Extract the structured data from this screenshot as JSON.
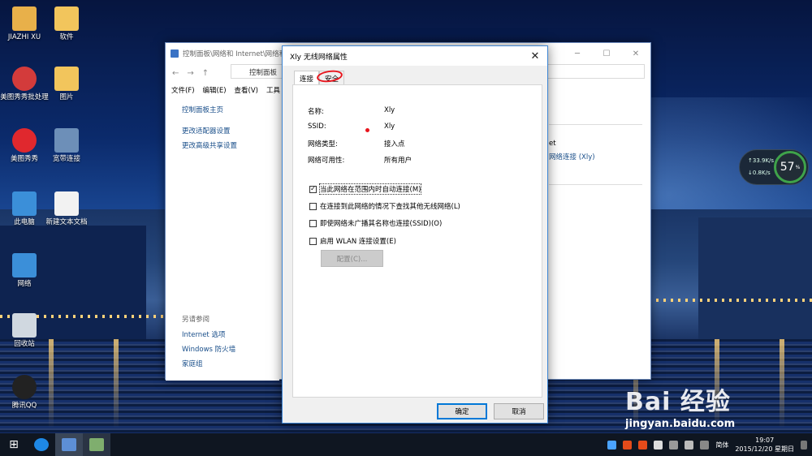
{
  "desktop_icons": [
    {
      "label": "JIAZHI XU",
      "icon": "user-folder-icon",
      "color": "#e8b04a"
    },
    {
      "label": "软件",
      "icon": "folder-icon",
      "color": "#f2c55c"
    },
    {
      "label": "美图秀秀批处理",
      "icon": "meitu-batch-icon",
      "color": "#d33b3b"
    },
    {
      "label": "图片",
      "icon": "folder-icon",
      "color": "#f2c55c"
    },
    {
      "label": "美图秀秀",
      "icon": "meitu-icon",
      "color": "#e0282e"
    },
    {
      "label": "宽带连接",
      "icon": "broadband-icon",
      "color": "#6d8fb8"
    },
    {
      "label": "此电脑",
      "icon": "computer-icon",
      "color": "#3b8fd9"
    },
    {
      "label": "新建文本文档",
      "icon": "text-document-icon",
      "color": "#f2f2f2"
    },
    {
      "label": "网络",
      "icon": "network-icon",
      "color": "#3b8fd9"
    },
    {
      "label": "回收站",
      "icon": "recycle-bin-icon",
      "color": "#d0d8e0"
    },
    {
      "label": "腾讯QQ",
      "icon": "qq-icon",
      "color": "#222222"
    }
  ],
  "control_panel": {
    "title": "控制面板\\网络和 Internet\\网络和",
    "address": "控制面板",
    "menu": [
      "文件(F)",
      "编辑(E)",
      "查看(V)",
      "工具"
    ],
    "side_links": [
      "控制面板主页",
      "更改适配器设置",
      "更改高级共享设置"
    ],
    "see_also_heading": "另请参阅",
    "see_also_links": [
      "Internet 选项",
      "Windows 防火墙",
      "家庭组"
    ],
    "right_frag_1": "et",
    "right_frag_2": "网络连接 (Xly)"
  },
  "dialog": {
    "title": "Xly 无线网络属性",
    "close": "✕",
    "tabs": [
      "连接",
      "安全"
    ],
    "props": [
      {
        "label": "名称:",
        "value": "Xly"
      },
      {
        "label": "SSID:",
        "value": "Xly"
      },
      {
        "label": "网络类型:",
        "value": "接入点"
      },
      {
        "label": "网络可用性:",
        "value": "所有用户"
      }
    ],
    "checkboxes": [
      {
        "label": "当此网络在范围内时自动连接(M)",
        "checked": true
      },
      {
        "label": "在连接到此网络的情况下查找其他无线网络(L)",
        "checked": false
      },
      {
        "label": "即使网络未广播其名称也连接(SSID)(O)",
        "checked": false
      },
      {
        "label": "启用 WLAN 连接设置(E)",
        "checked": false
      }
    ],
    "config_button": "配置(C)...",
    "ok": "确定",
    "cancel": "取消"
  },
  "net_widget": {
    "up": "33.9",
    "down": "0.8",
    "unit": "K/s",
    "percent": "57",
    "percent_unit": "%"
  },
  "taskbar": {
    "start": "⊞",
    "apps": [
      "browser-icon",
      "control-panel-icon",
      "photo-icon"
    ],
    "ime": "简体",
    "time": "19:07",
    "date": "2015/12/20 星期日"
  },
  "watermark": {
    "text": "Bai 经验",
    "url": "jingyan.baidu.com"
  }
}
